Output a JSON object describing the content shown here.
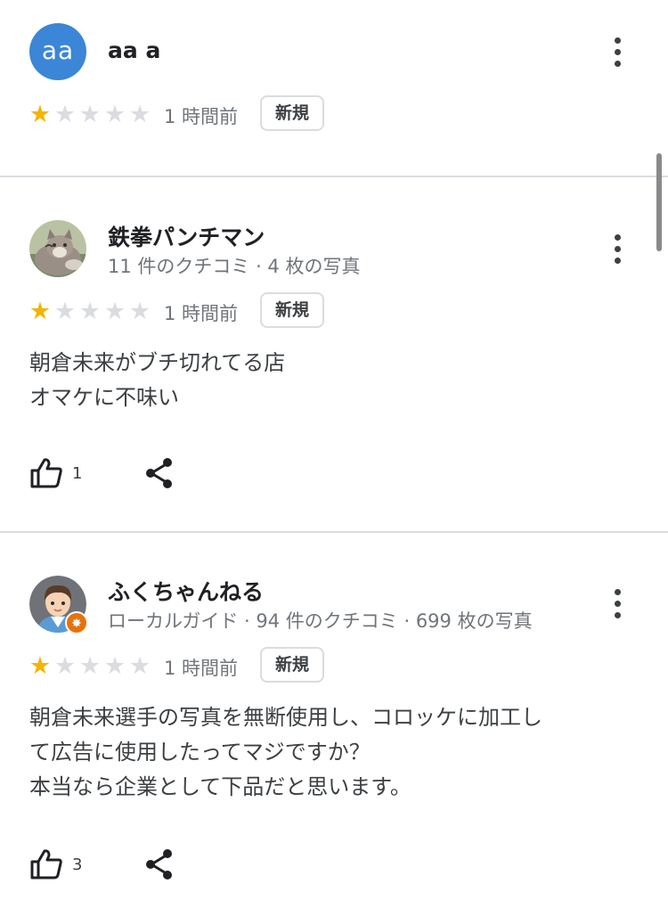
{
  "reviews": [
    {
      "avatar_initials": "aa",
      "name": "aa a",
      "rating": 1,
      "time": "1 時間前",
      "badge": "新規"
    },
    {
      "avatar_icon": "cat-photo-avatar",
      "name": "鉄拳パンチマン",
      "meta": "11 件のクチコミ · 4 枚の写真",
      "rating": 1,
      "time": "1 時間前",
      "badge": "新規",
      "text_lines": [
        "朝倉未来がブチ切れてる店",
        "オマケに不味い"
      ],
      "likes": "1"
    },
    {
      "avatar_icon": "illustrated-person-avatar",
      "name": "ふくちゃんねる",
      "meta": "ローカルガイド · 94 件のクチコミ · 699 枚の写真",
      "rating": 1,
      "time": "1 時間前",
      "badge": "新規",
      "text_lines": [
        "朝倉未来選手の写真を無断使用し、コロッケに加工し",
        "て広告に使用したってマジですか？",
        "本当なら企業として下品だと思います。"
      ],
      "likes": "3"
    }
  ],
  "icons": {
    "more": "more-vert-icon",
    "like": "thumb-up-icon",
    "share": "share-icon",
    "star": "star-icon",
    "local_guide": "local-guide-badge-icon"
  },
  "colors": {
    "star_filled": "#f5b400",
    "star_empty": "#dadce0",
    "avatar_blue": "#3b86d6",
    "local_guide_orange": "#e8710a"
  }
}
